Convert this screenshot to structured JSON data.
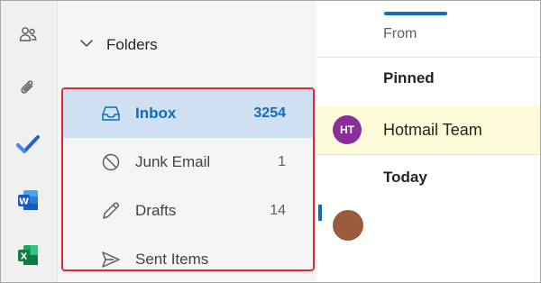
{
  "rail": {
    "items": [
      {
        "icon": "people-icon"
      },
      {
        "icon": "paperclip-icon"
      },
      {
        "icon": "todo-check-icon",
        "color": "#2564cf"
      },
      {
        "icon": "word-icon",
        "color": "#185abd"
      },
      {
        "icon": "excel-icon",
        "color": "#107c41"
      }
    ]
  },
  "folders": {
    "header": "Folders",
    "items": [
      {
        "label": "Inbox",
        "count": "3254",
        "icon": "inbox-icon",
        "selected": true
      },
      {
        "label": "Junk Email",
        "count": "1",
        "icon": "junk-icon"
      },
      {
        "label": "Drafts",
        "count": "14",
        "icon": "pencil-icon"
      },
      {
        "label": "Sent Items",
        "count": "",
        "icon": "send-icon"
      }
    ]
  },
  "message_list": {
    "column_from": "From",
    "sections": {
      "pinned": "Pinned",
      "today": "Today"
    },
    "pinned_message": {
      "initials": "HT",
      "sender": "Hotmail Team",
      "avatar_color": "#8a2e9c"
    }
  },
  "colors": {
    "accent": "#0f6cbd",
    "selection": "#cfe0f3",
    "highlight_border": "#e0282e",
    "pinned_bg": "#fdfbd8"
  }
}
